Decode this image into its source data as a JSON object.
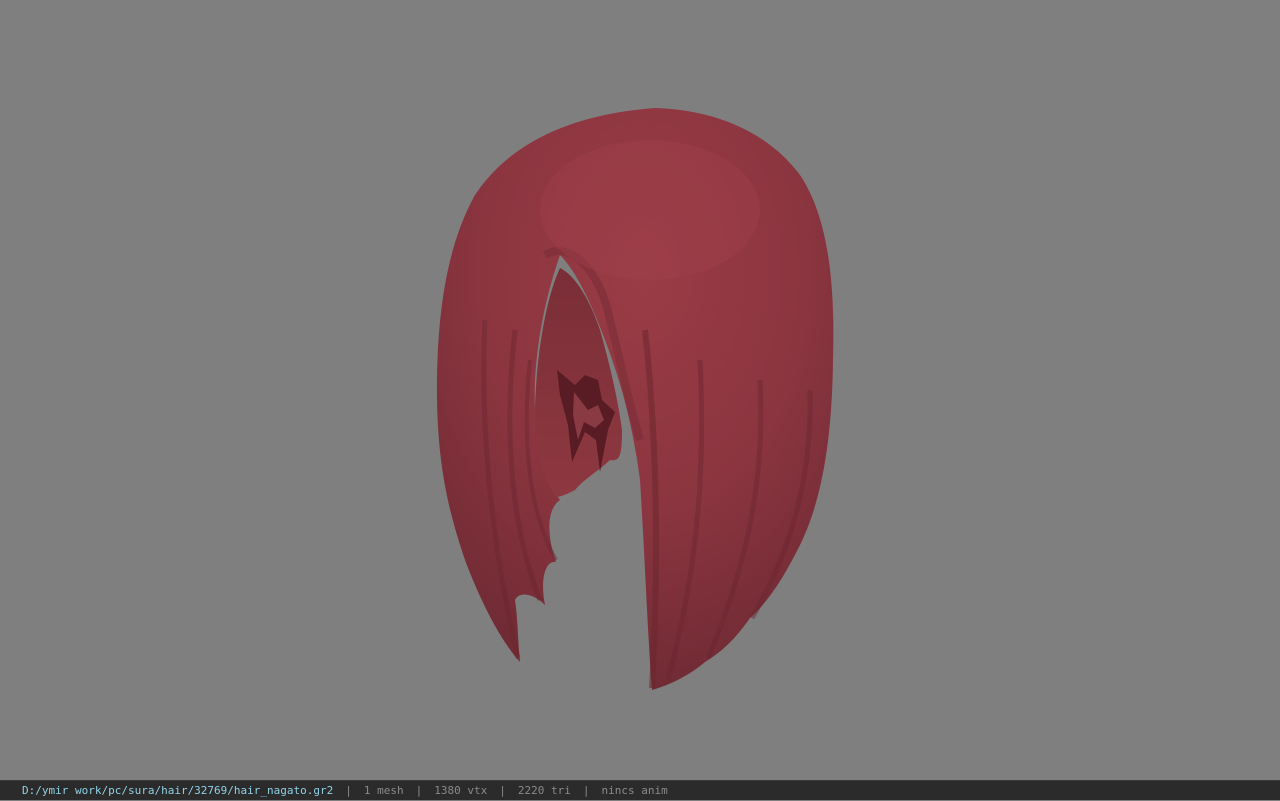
{
  "viewport": {
    "background_color": "#7f7f7f",
    "model_color": "#933a43"
  },
  "statusbar": {
    "file_path": "D:/ymir work/pc/sura/hair/32769/hair_nagato.gr2",
    "separator": "|",
    "mesh_count": "1 mesh",
    "vertex_count": "1380 vtx",
    "triangle_count": "2220 tri",
    "anim_status": "nincs anim"
  }
}
